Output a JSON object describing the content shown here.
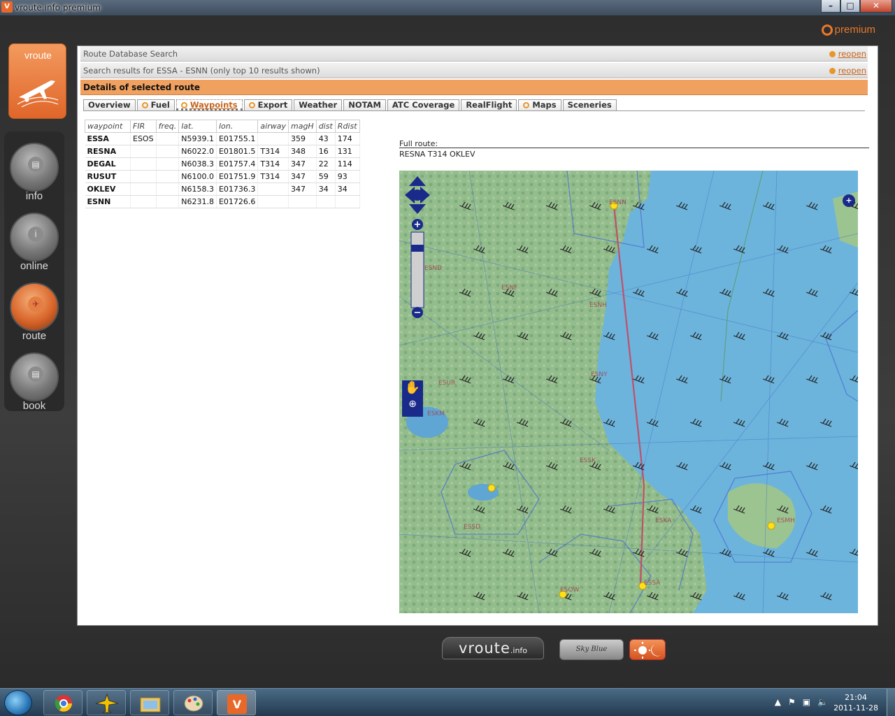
{
  "window": {
    "title": "vroute.info premium",
    "icon_text": "V"
  },
  "header": {
    "premium_label": "premium"
  },
  "logo": {
    "text": "vroute"
  },
  "sidebar": {
    "items": [
      {
        "label": "info",
        "icon": "info-document-icon"
      },
      {
        "label": "online",
        "icon": "online-info-icon"
      },
      {
        "label": "route",
        "icon": "route-plane-icon",
        "active": true
      },
      {
        "label": "book",
        "icon": "book-icon"
      }
    ]
  },
  "panels": {
    "route_db_search": {
      "title": "Route Database Search",
      "reopen": "reopen"
    },
    "search_results": {
      "title": "Search results for ESSA - ESNN (only top 10 results shown)",
      "reopen": "reopen"
    },
    "details": {
      "title": "Details of selected route"
    }
  },
  "tabs": [
    {
      "label": "Overview",
      "sun": false
    },
    {
      "label": "Fuel",
      "sun": true
    },
    {
      "label": "Waypoints",
      "sun": true,
      "active": true
    },
    {
      "label": "Export",
      "sun": true
    },
    {
      "label": "Weather",
      "sun": false
    },
    {
      "label": "NOTAM",
      "sun": false
    },
    {
      "label": "ATC Coverage",
      "sun": false
    },
    {
      "label": "RealFlight",
      "sun": false
    },
    {
      "label": "Maps",
      "sun": true
    },
    {
      "label": "Sceneries",
      "sun": false
    }
  ],
  "waypoints": {
    "columns": [
      "waypoint",
      "FIR",
      "freq.",
      "lat.",
      "lon.",
      "airway",
      "magH",
      "dist",
      "Rdist"
    ],
    "rows": [
      [
        "ESSA",
        "ESOS",
        "",
        "N5939.1",
        "E01755.1",
        "",
        "359",
        "43",
        "174"
      ],
      [
        "RESNA",
        "",
        "",
        "N6022.0",
        "E01801.5",
        "T314",
        "348",
        "16",
        "131"
      ],
      [
        "DEGAL",
        "",
        "",
        "N6038.3",
        "E01757.4",
        "T314",
        "347",
        "22",
        "114"
      ],
      [
        "RUSUT",
        "",
        "",
        "N6100.0",
        "E01751.9",
        "T314",
        "347",
        "59",
        "93"
      ],
      [
        "OKLEV",
        "",
        "",
        "N6158.3",
        "E01736.3",
        "",
        "347",
        "34",
        "34"
      ],
      [
        "ESNN",
        "",
        "",
        "N6231.8",
        "E01726.6",
        "",
        "",
        "",
        ""
      ]
    ]
  },
  "full_route": {
    "label": "Full route:",
    "value": "RESNA T314 OKLEV"
  },
  "map": {
    "labels": [
      "ESND",
      "ESNF",
      "ESNH",
      "ESNY",
      "ESUR",
      "ESKM",
      "ESSK",
      "ESSD",
      "ESKA",
      "ESSA",
      "ESOW",
      "ESNN",
      "ESMH"
    ],
    "colors": {
      "sea": "#6cb4dc",
      "land": "#8fb98a",
      "route": "#c0506a",
      "fir": "#4a6fd0"
    }
  },
  "footer": {
    "brand": "vroute",
    "brand_suffix": ".info",
    "skyblue": "Sky Blue"
  },
  "taskbar": {
    "time": "21:04",
    "date": "2011-11-28"
  }
}
